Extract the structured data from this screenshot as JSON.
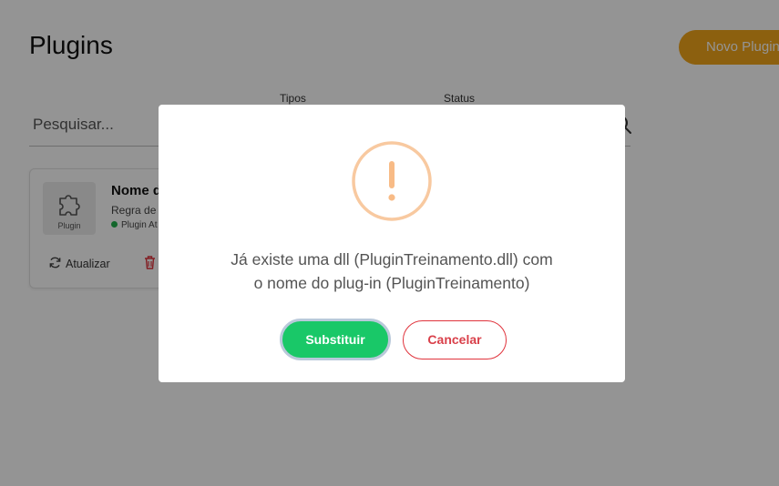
{
  "page": {
    "title": "Plugins",
    "new_plugin_label": "Novo Plugin"
  },
  "search": {
    "placeholder": "Pesquisar...",
    "value": ""
  },
  "filters": {
    "types_label": "Tipos",
    "status_label": "Status"
  },
  "plugin_card": {
    "thumb_label": "Plugin",
    "name": "Nome d",
    "rule": "Regra de",
    "status": "Plugin At",
    "status_color": "#22b04b",
    "update_label": "Atualizar"
  },
  "dialog": {
    "icon": "warning-icon",
    "message_line1": "Já existe uma dll (PluginTreinamento.dll) com",
    "message_line2": "o nome do plug-in (PluginTreinamento)",
    "confirm_label": "Substituir",
    "cancel_label": "Cancelar"
  },
  "colors": {
    "accent": "#f2a51a",
    "confirm": "#19c868",
    "cancel": "#d9404a",
    "warning": "#f8c9a0"
  }
}
